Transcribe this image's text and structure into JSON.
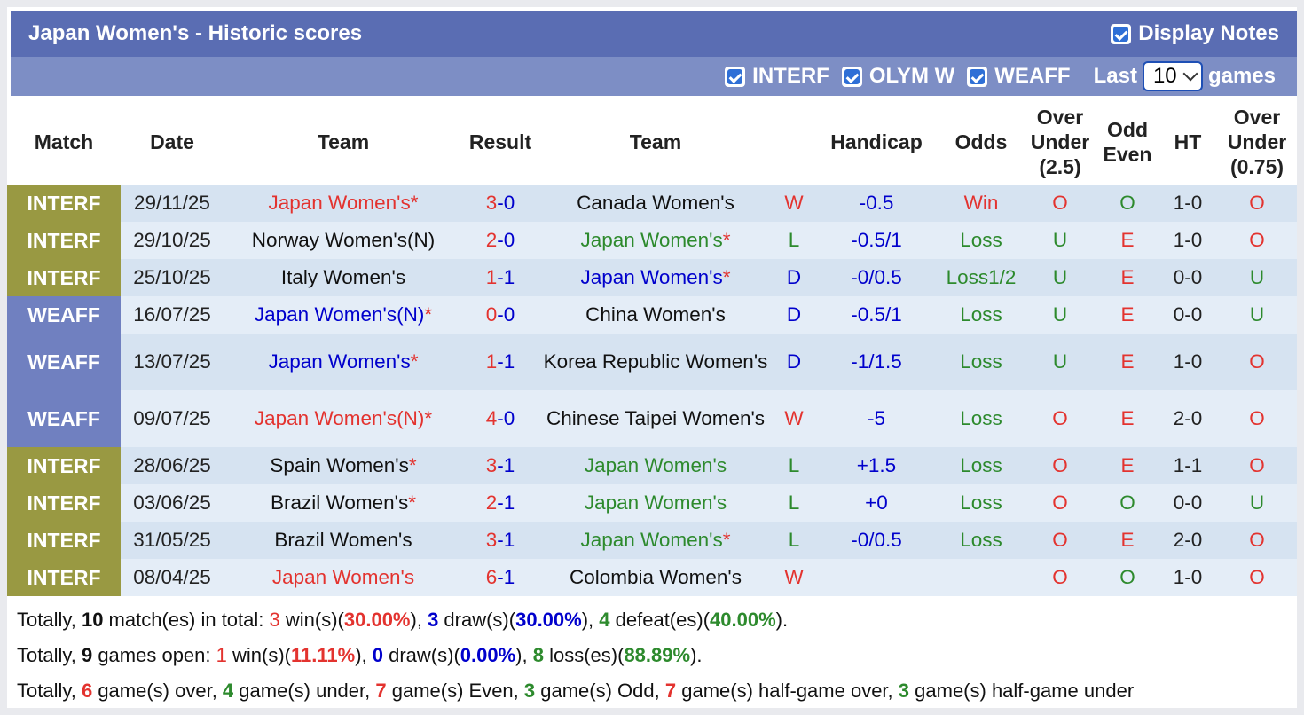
{
  "header": {
    "title": "Japan Women's - Historic scores",
    "display_notes": "Display Notes"
  },
  "filters": {
    "items": [
      "INTERF",
      "OLYM W",
      "WEAFF"
    ],
    "last_label": "Last",
    "last_value": "10",
    "games_label": "games"
  },
  "columns": [
    "Match",
    "Date",
    "Team",
    "Result",
    "Team",
    "",
    "Handicap",
    "Odds",
    "Over Under (2.5)",
    "Odd Even",
    "HT",
    "Over Under (0.75)"
  ],
  "colors": {
    "interf": "#999942",
    "weaff": "#7080c0",
    "win": "#e3332f",
    "loss": "#2d8a2d",
    "draw": "#1a1aa8"
  },
  "rows": [
    {
      "comp": "INTERF",
      "date": "29/11/25",
      "home": "Japan Women's",
      "home_star": "*",
      "res_h": "3",
      "res_a": "0",
      "away": "Canada Women's",
      "away_star": "",
      "wld": "W",
      "hc": "-0.5",
      "odds": "Win",
      "ou": "O",
      "oe": "O",
      "ht": "1-0",
      "ou2": "O"
    },
    {
      "comp": "INTERF",
      "date": "29/10/25",
      "home": "Norway Women's(N)",
      "home_star": "",
      "res_h": "2",
      "res_a": "0",
      "away": "Japan Women's",
      "away_star": "*",
      "wld": "L",
      "hc": "-0.5/1",
      "odds": "Loss",
      "ou": "U",
      "oe": "E",
      "ht": "1-0",
      "ou2": "O"
    },
    {
      "comp": "INTERF",
      "date": "25/10/25",
      "home": "Italy Women's",
      "home_star": "",
      "res_h": "1",
      "res_a": "1",
      "away": "Japan Women's",
      "away_star": "*",
      "wld": "D",
      "hc": "-0/0.5",
      "odds": "Loss1/2",
      "ou": "U",
      "oe": "E",
      "ht": "0-0",
      "ou2": "U"
    },
    {
      "comp": "WEAFF",
      "date": "16/07/25",
      "home": "Japan Women's(N)",
      "home_star": "*",
      "res_h": "0",
      "res_a": "0",
      "away": "China Women's",
      "away_star": "",
      "wld": "D",
      "hc": "-0.5/1",
      "odds": "Loss",
      "ou": "U",
      "oe": "E",
      "ht": "0-0",
      "ou2": "U"
    },
    {
      "comp": "WEAFF",
      "date": "13/07/25",
      "home": "Japan Women's",
      "home_star": "*",
      "res_h": "1",
      "res_a": "1",
      "away": "Korea Republic Women's",
      "away_star": "",
      "wld": "D",
      "hc": "-1/1.5",
      "odds": "Loss",
      "ou": "U",
      "oe": "E",
      "ht": "1-0",
      "ou2": "O"
    },
    {
      "comp": "WEAFF",
      "date": "09/07/25",
      "home": "Japan Women's(N)",
      "home_star": "*",
      "res_h": "4",
      "res_a": "0",
      "away": "Chinese Taipei Women's",
      "away_star": "",
      "wld": "W",
      "hc": "-5",
      "odds": "Loss",
      "ou": "O",
      "oe": "E",
      "ht": "2-0",
      "ou2": "O"
    },
    {
      "comp": "INTERF",
      "date": "28/06/25",
      "home": "Spain Women's",
      "home_star": "*",
      "res_h": "3",
      "res_a": "1",
      "away": "Japan Women's",
      "away_star": "",
      "wld": "L",
      "hc": "+1.5",
      "odds": "Loss",
      "ou": "O",
      "oe": "E",
      "ht": "1-1",
      "ou2": "O"
    },
    {
      "comp": "INTERF",
      "date": "03/06/25",
      "home": "Brazil Women's",
      "home_star": "*",
      "res_h": "2",
      "res_a": "1",
      "away": "Japan Women's",
      "away_star": "",
      "wld": "L",
      "hc": "+0",
      "odds": "Loss",
      "ou": "O",
      "oe": "O",
      "ht": "0-0",
      "ou2": "U"
    },
    {
      "comp": "INTERF",
      "date": "31/05/25",
      "home": "Brazil Women's",
      "home_star": "",
      "res_h": "3",
      "res_a": "1",
      "away": "Japan Women's",
      "away_star": "*",
      "wld": "L",
      "hc": "-0/0.5",
      "odds": "Loss",
      "ou": "O",
      "oe": "E",
      "ht": "2-0",
      "ou2": "O"
    },
    {
      "comp": "INTERF",
      "date": "08/04/25",
      "home": "Japan Women's",
      "home_star": "",
      "res_h": "6",
      "res_a": "1",
      "away": "Colombia Women's",
      "away_star": "",
      "wld": "W",
      "hc": "",
      "odds": "",
      "ou": "O",
      "oe": "O",
      "ht": "1-0",
      "ou2": "O"
    }
  ],
  "summary": {
    "l1": {
      "a": "Totally, ",
      "n_matches": "10",
      "b": " match(es) in total: ",
      "wins": "3",
      "c": " win(s)(",
      "win_pct": "30.00%",
      "d": "), ",
      "draws": "3",
      "e": " draw(s)(",
      "draw_pct": "30.00%",
      "f": "), ",
      "defeats": "4",
      "g": " defeat(es)(",
      "def_pct": "40.00%",
      "h": ")."
    },
    "l2": {
      "a": "Totally, ",
      "n_open": "9",
      "b": " games open: ",
      "wins": "1",
      "c": " win(s)(",
      "win_pct": "11.11%",
      "d": "), ",
      "draws": "0",
      "e": " draw(s)(",
      "draw_pct": "0.00%",
      "f": "), ",
      "losses": "8",
      "g": " loss(es)(",
      "loss_pct": "88.89%",
      "h": ")."
    },
    "l3": {
      "a": "Totally, ",
      "over": "6",
      "b": " game(s) over, ",
      "under": "4",
      "c": " game(s) under, ",
      "even": "7",
      "d": " game(s) Even, ",
      "odd": "3",
      "e": " game(s) Odd, ",
      "hg_over": "7",
      "f": " game(s) half-game over, ",
      "hg_under": "3",
      "g": " game(s) half-game under"
    }
  }
}
